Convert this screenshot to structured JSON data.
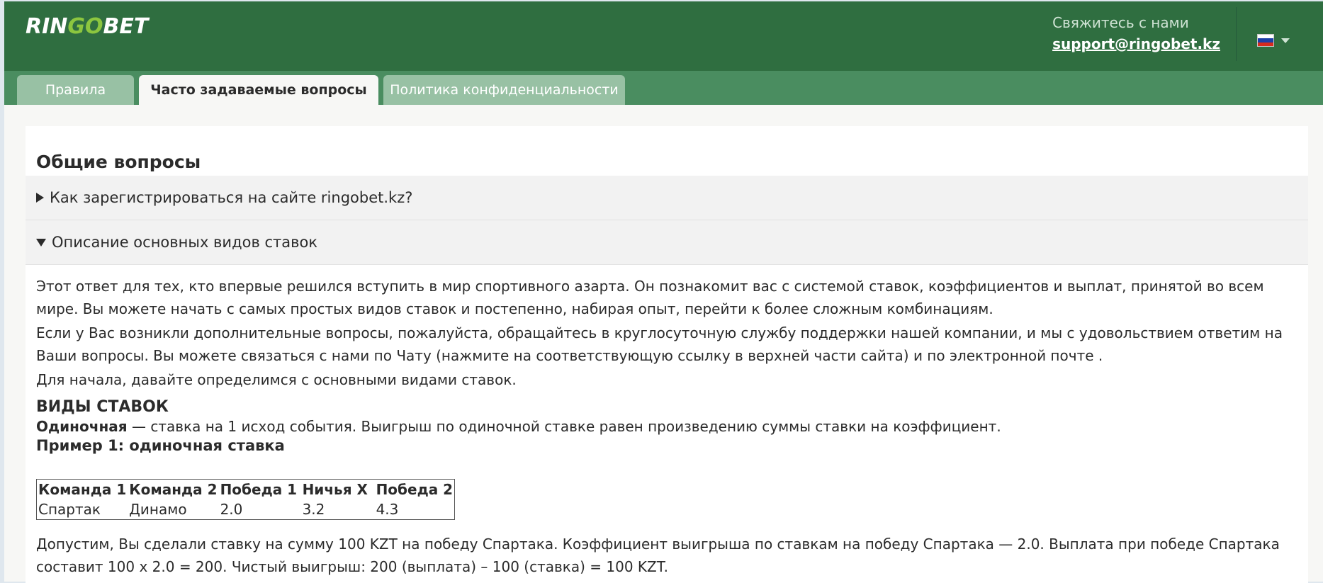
{
  "brand": {
    "logo_part1": "RIN",
    "logo_part2": "GO",
    "logo_part3": "BET"
  },
  "contact": {
    "title": "Свяжитесь с нами",
    "email": "support@ringobet.kz"
  },
  "language": {
    "flag": "russia-flag-icon"
  },
  "tabs": [
    {
      "label": "Правила",
      "active": false
    },
    {
      "label": "Часто задаваемые вопросы",
      "active": true
    },
    {
      "label": "Политика конфиденциальности",
      "active": false
    }
  ],
  "section": {
    "title": "Общие вопросы"
  },
  "faq": [
    {
      "question": "Как зарегистрироваться на сайте ringobet.kz?",
      "expanded": false
    },
    {
      "question": "Описание основных видов ставок",
      "expanded": true
    }
  ],
  "answer": {
    "p1": "Этот ответ для тех, кто впервые решился вступить в мир спортивного азарта. Он познакомит вас с системой ставок, коэффициентов и выплат, принятой во всем мире. Вы можете начать с самых простых видов ставок и постепенно, набирая опыт, перейти к более сложным комбинациям.",
    "p2": "Если у Вас возникли дополнительные вопросы, пожалуйста, обращайтесь в круглосуточную службу поддержки нашей компании, и мы с удовольствием ответим на Ваши вопросы. Вы можете связаться с нами по Чату (нажмите на соответствующую ссылку в верхней части сайта) и по электронной почте .",
    "p3": "Для начала, давайте определимся с основными видами ставок.",
    "types_heading": "ВИДЫ СТАВОК",
    "single_term": "Одиночная",
    "single_def": " — ставка на 1 исход события. Выигрыш по одиночной ставке равен произведению суммы ставки на коэффициент.",
    "example_title": "Пример 1: одиночная ставка",
    "table": {
      "headers": [
        "Команда 1",
        "Команда 2",
        "Победа 1",
        "Ничья X",
        "Победа 2"
      ],
      "row": [
        "Спартак",
        "Динамо",
        "2.0",
        "3.2",
        "4.3"
      ]
    },
    "p4": "Допустим, Вы сделали ставку на сумму 100 KZT на победу Спартака. Коэффициент выигрыша по ставкам на победу Спартака — 2.0. Выплата при победе Спартака составит 100 x 2.0 = 200. Чистый выигрыш: 200 (выплата) – 100 (ставка) = 100 KZT."
  },
  "colors": {
    "header": "#2f6e40",
    "tabbar": "#4a8d60",
    "tab_inactive": "#98c1a4"
  }
}
